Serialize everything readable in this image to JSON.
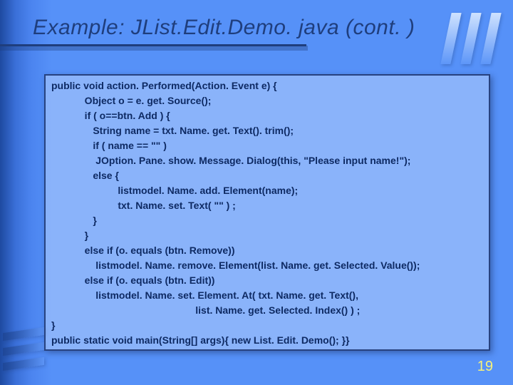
{
  "title": "Example: JList.Edit.Demo. java (cont. )",
  "code": {
    "l1": "public void action. Performed(Action. Event e) {",
    "l2": "            Object o = e. get. Source();",
    "l3": "            if ( o==btn. Add ) {",
    "l4": "               String name = txt. Name. get. Text(). trim();",
    "l5": "               if ( name == \"\" )",
    "l6": "                JOption. Pane. show. Message. Dialog(this, \"Please input name!\");",
    "l7": "               else {",
    "l8": "                        listmodel. Name. add. Element(name);",
    "l9": "                        txt. Name. set. Text( \"\" ) ;",
    "l10": "               }",
    "l11": "            }",
    "l12": "            else if (o. equals (btn. Remove))",
    "l13": "                listmodel. Name. remove. Element(list. Name. get. Selected. Value());",
    "l14": "            else if (o. equals (btn. Edit))",
    "l15": "                listmodel. Name. set. Element. At( txt. Name. get. Text(),",
    "l16": "                                                    list. Name. get. Selected. Index() ) ;",
    "l17": "}",
    "l18": "public static void main(String[] args){ new List. Edit. Demo(); }}"
  },
  "page_number": "19"
}
